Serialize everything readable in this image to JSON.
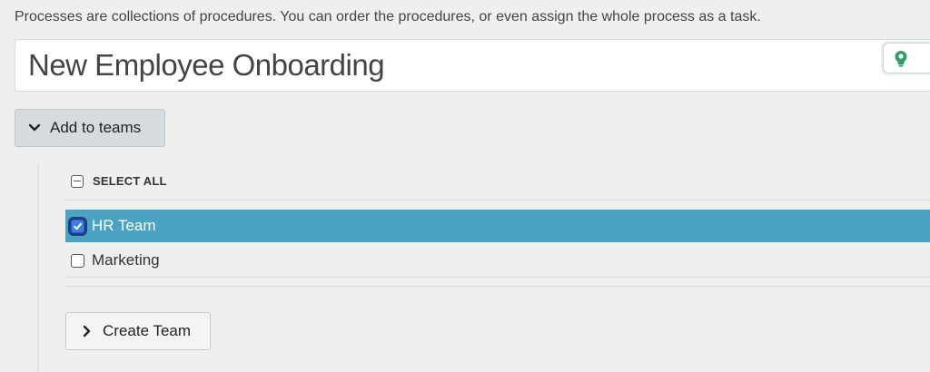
{
  "intro_text": "Processes are collections of procedures. You can order the procedures, or even assign the whole process as a task.",
  "process_title": "New Employee Onboarding",
  "add_to_teams_label": "Add to teams",
  "select_all_label": "SELECT ALL",
  "teams": [
    {
      "name": "HR Team",
      "checked": true,
      "selected": true
    },
    {
      "name": "Marketing",
      "checked": false,
      "selected": false
    }
  ],
  "create_team_label": "Create Team",
  "colors": {
    "selected_row": "#4aa3c1",
    "checkbox_checked": "#3f7fe0",
    "hint_icon": "#2e9e6b"
  },
  "icons": {
    "add_to_teams": "chevron-down-icon",
    "create_team": "chevron-right-icon",
    "hint": "lightbulb-icon",
    "select_all": "minus-square-icon"
  }
}
